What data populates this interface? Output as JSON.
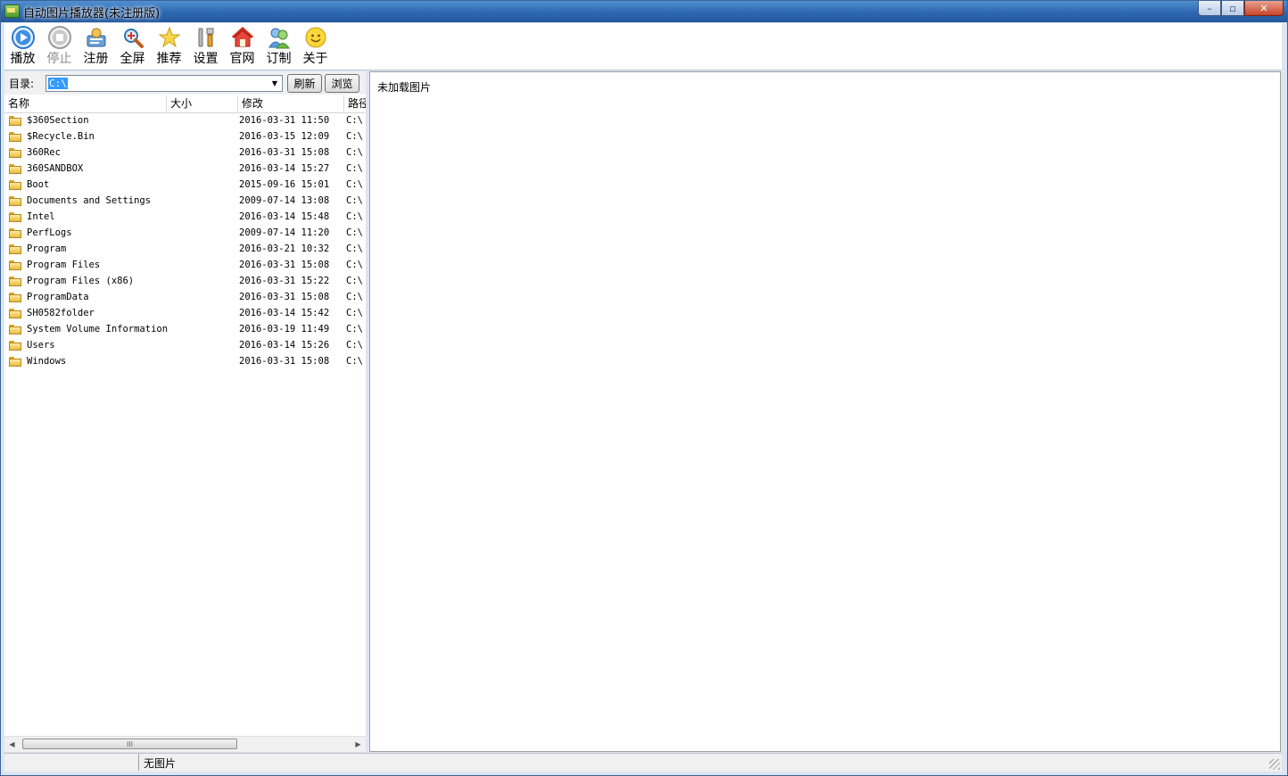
{
  "window": {
    "title": "自动图片播放器(未注册版)"
  },
  "caption_buttons": {
    "minimize": "–",
    "maximize": "▫",
    "close": "✕"
  },
  "toolbar": [
    {
      "id": "play",
      "label": "播放",
      "icon": "play-icon",
      "enabled": true
    },
    {
      "id": "stop",
      "label": "停止",
      "icon": "stop-icon",
      "enabled": false
    },
    {
      "id": "register",
      "label": "注册",
      "icon": "register-icon",
      "enabled": true
    },
    {
      "id": "fullscreen",
      "label": "全屏",
      "icon": "fullscreen-icon",
      "enabled": true
    },
    {
      "id": "recommend",
      "label": "推荐",
      "icon": "star-icon",
      "enabled": true
    },
    {
      "id": "settings",
      "label": "设置",
      "icon": "tools-icon",
      "enabled": true
    },
    {
      "id": "website",
      "label": "官网",
      "icon": "home-icon",
      "enabled": true
    },
    {
      "id": "custom",
      "label": "订制",
      "icon": "users-icon",
      "enabled": true
    },
    {
      "id": "about",
      "label": "关于",
      "icon": "smiley-icon",
      "enabled": true
    }
  ],
  "directory": {
    "label": "目录:",
    "value": "C:\\",
    "refresh_label": "刷新",
    "browse_label": "浏览"
  },
  "file_list": {
    "columns": [
      "名称",
      "大小",
      "修改",
      "路径"
    ],
    "rows": [
      {
        "name": "$360Section",
        "size": "",
        "modified": "2016-03-31 11:50",
        "path": "C:\\"
      },
      {
        "name": "$Recycle.Bin",
        "size": "",
        "modified": "2016-03-15 12:09",
        "path": "C:\\"
      },
      {
        "name": "360Rec",
        "size": "",
        "modified": "2016-03-31 15:08",
        "path": "C:\\"
      },
      {
        "name": "360SANDBOX",
        "size": "",
        "modified": "2016-03-14 15:27",
        "path": "C:\\"
      },
      {
        "name": "Boot",
        "size": "",
        "modified": "2015-09-16 15:01",
        "path": "C:\\"
      },
      {
        "name": "Documents and Settings",
        "size": "",
        "modified": "2009-07-14 13:08",
        "path": "C:\\"
      },
      {
        "name": "Intel",
        "size": "",
        "modified": "2016-03-14 15:48",
        "path": "C:\\"
      },
      {
        "name": "PerfLogs",
        "size": "",
        "modified": "2009-07-14 11:20",
        "path": "C:\\"
      },
      {
        "name": "Program",
        "size": "",
        "modified": "2016-03-21 10:32",
        "path": "C:\\"
      },
      {
        "name": "Program Files",
        "size": "",
        "modified": "2016-03-31 15:08",
        "path": "C:\\"
      },
      {
        "name": "Program Files (x86)",
        "size": "",
        "modified": "2016-03-31 15:22",
        "path": "C:\\"
      },
      {
        "name": "ProgramData",
        "size": "",
        "modified": "2016-03-31 15:08",
        "path": "C:\\"
      },
      {
        "name": "SH0582folder",
        "size": "",
        "modified": "2016-03-14 15:42",
        "path": "C:\\"
      },
      {
        "name": "System Volume Information",
        "size": "",
        "modified": "2016-03-19 11:49",
        "path": "C:\\"
      },
      {
        "name": "Users",
        "size": "",
        "modified": "2016-03-14 15:26",
        "path": "C:\\"
      },
      {
        "name": "Windows",
        "size": "",
        "modified": "2016-03-31 15:08",
        "path": "C:\\"
      }
    ]
  },
  "hscroll": {
    "thumb_grip": "III"
  },
  "viewer": {
    "message": "未加载图片"
  },
  "statusbar": {
    "text": "无图片"
  }
}
